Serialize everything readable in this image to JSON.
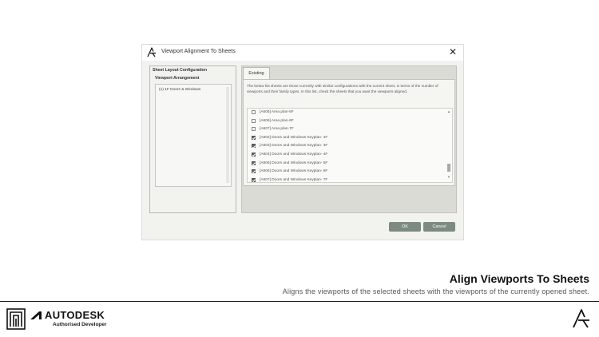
{
  "dialog": {
    "title": "Viewport Alignment To Sheets",
    "close_glyph": "✕",
    "logo_icon": "stylized-a-logo-icon",
    "left_panel": {
      "group_label": "Sheet Layout Configuration",
      "arrangement_label": "Viewport Arrangement",
      "items": [
        "(1) 1F Doors & Windows"
      ]
    },
    "tab_label": "Existing",
    "description": "The below list sheets are those currently with similar configurations with the current sheet, in terms of the number of viewports and their family types. In this list, check the sheets that you want the viewports aligned.",
    "sheets": [
      {
        "label": "[A605] Area plan-5F",
        "checked": false
      },
      {
        "label": "[A606] Area plan-6F",
        "checked": false
      },
      {
        "label": "[A607] Area plan-7F",
        "checked": false
      },
      {
        "label": "[A802] Doors and Windows Keyplan- 2F",
        "checked": true
      },
      {
        "label": "[A803] Doors and Windows Keyplan- 3F",
        "checked": true
      },
      {
        "label": "[A804] Doors and Windows Keyplan- 4F",
        "checked": true
      },
      {
        "label": "[A805] Doors and Windows Keyplan- 5F",
        "checked": true
      },
      {
        "label": "[A806] Doors and Windows Keyplan- 6F",
        "checked": true
      },
      {
        "label": "[A807] Doors and Windows Keyplan- 7F",
        "checked": true
      }
    ],
    "ok_label": "OK",
    "cancel_label": "Cancel"
  },
  "hero": {
    "title": "Align Viewports To Sheets",
    "subtitle": "Aligns the viewports of the selected sheets with the viewports of the currently opened sheet."
  },
  "footer": {
    "brand_word": "AUTODESK",
    "brand_sub": "Authorised Developer",
    "brand_icon": "autodesk-logo-icon",
    "app_logo_icon": "stylized-a-logo-icon"
  }
}
